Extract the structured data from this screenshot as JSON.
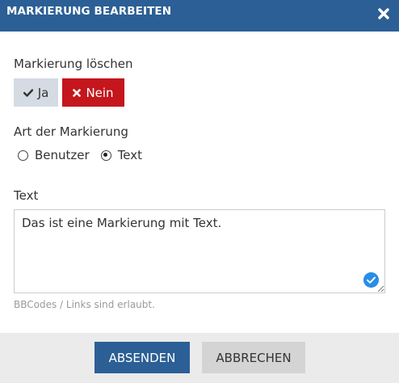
{
  "dialog": {
    "title": "MARKIERUNG BEARBEITEN",
    "close_icon": "close-icon"
  },
  "delete_marker": {
    "label": "Markierung löschen",
    "yes_label": "Ja",
    "no_label": "Nein",
    "selected": "Nein",
    "colors": {
      "yes_bg": "#d4dbe2",
      "no_bg": "#c4161c"
    }
  },
  "marker_type": {
    "label": "Art der Markierung",
    "options": [
      "Benutzer",
      "Text"
    ],
    "selected": "Text"
  },
  "text_field": {
    "label": "Text",
    "value": "Das ist eine Markierung mit Text.",
    "hint": "BBCodes / Links sind erlaubt."
  },
  "footer": {
    "submit_label": "ABSENDEN",
    "cancel_label": "ABBRECHEN"
  },
  "colors": {
    "header_bg": "#2b5f95",
    "primary": "#2b5f95",
    "danger": "#c4161c",
    "footer_bg": "#ebebeb"
  }
}
